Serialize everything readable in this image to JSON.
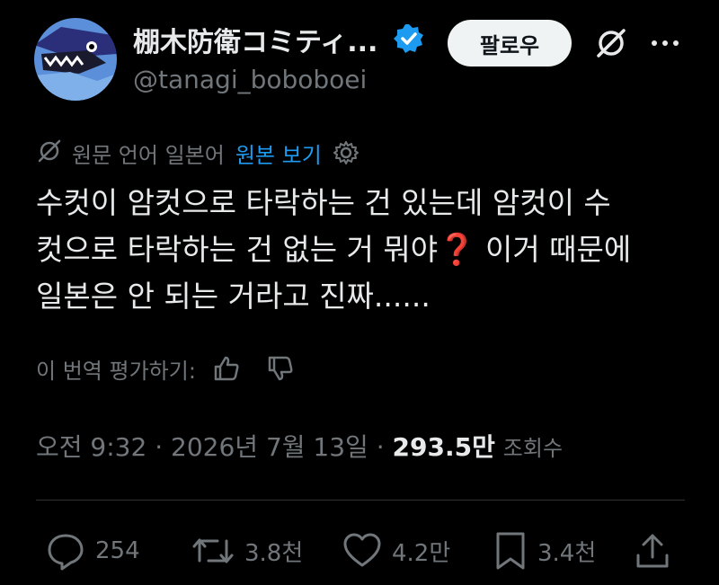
{
  "author": {
    "display_name": "棚木防衛コミティ...",
    "handle": "@tanagi_boboboei"
  },
  "header": {
    "follow_label": "팔로우"
  },
  "translation": {
    "label": "원문 언어 일본어",
    "show_original": "원본 보기"
  },
  "post": {
    "line1": "수컷이 암컷으로 타락하는 건 있는데 암컷이 수",
    "line2": "컷으로 타락하는 건 없는 거 뭐야",
    "line2_emoji": "❓",
    "line2_tail": " 이거 때문에",
    "line3": "일본은 안 되는 거라고 진짜......"
  },
  "rate": {
    "label": "이 번역 평가하기:"
  },
  "meta": {
    "time": "오전 9:32",
    "date": "2026년 7월 13일",
    "views": "293.5만",
    "views_label": "조회수"
  },
  "actions": {
    "replies": "254",
    "reposts": "3.8천",
    "likes": "4.2만",
    "bookmarks": "3.4천"
  },
  "colors": {
    "accent": "#1d9bf0",
    "muted": "#71767b",
    "text": "#e7e9ea",
    "background": "#000000"
  },
  "icons": [
    "verified-badge-icon",
    "grok-icon",
    "more-icon",
    "translate-icon",
    "gear-icon",
    "thumbs-up-icon",
    "thumbs-down-icon",
    "reply-icon",
    "repost-icon",
    "like-icon",
    "bookmark-icon",
    "share-icon"
  ]
}
